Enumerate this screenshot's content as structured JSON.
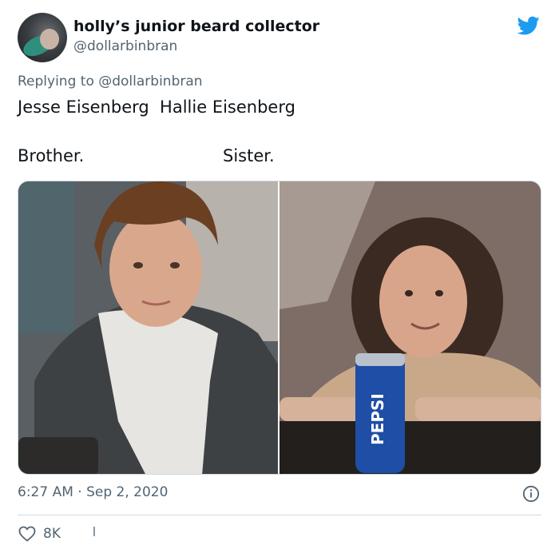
{
  "tweet": {
    "display_name": "holly’s junior beard collector",
    "handle": "@dollarbinbran",
    "replying_to": "Replying to @dollarbinbran",
    "line1": "Jesse Eisenberg  Hallie Eisenberg",
    "line2_left": "Brother.",
    "line2_right": "Sister.",
    "image_left_icon": "photo-young-man",
    "image_right_icon": "photo-young-girl-pepsi",
    "can_label": "PEPSI",
    "timestamp": "6:27 AM · Sep 2, 2020",
    "likes_count": "8K"
  },
  "colors": {
    "twitter_blue": "#1d9bf0",
    "text_primary": "#0f1419",
    "text_secondary": "#536471",
    "border": "#cfd9de"
  }
}
